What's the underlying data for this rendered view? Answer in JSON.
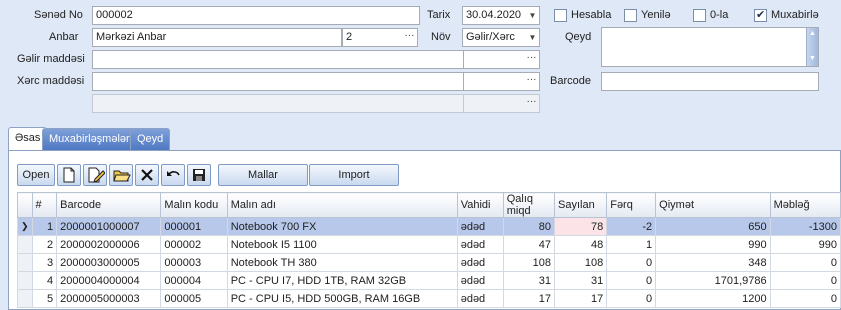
{
  "form": {
    "doc_no_label": "Sənəd No",
    "doc_no_value": "000002",
    "date_label": "Tarix",
    "date_value": "30.04.2020",
    "anbar_label": "Anbar",
    "anbar_value": "Mərkəzi Anbar",
    "anbar_code": "2",
    "nov_label": "Növ",
    "nov_value": "Gəlir/Xərc",
    "qeyd_label": "Qeyd",
    "gelir_label": "Gəlir maddəsi",
    "xerc_label": "Xərc maddəsi",
    "barcode_label": "Barcode"
  },
  "checkboxes": [
    {
      "label": "Hesabla",
      "checked": false
    },
    {
      "label": "Yenilə",
      "checked": false
    },
    {
      "label": "0-la",
      "checked": false
    },
    {
      "label": "Muxabirlə",
      "checked": true
    }
  ],
  "tabs": [
    "Əsas",
    "Muxabirləşmələr",
    "Qeyd"
  ],
  "toolbar": {
    "open": "Open",
    "mallar": "Mallar",
    "import": "Import"
  },
  "table": {
    "headers": [
      "#",
      "Barcode",
      "Malın kodu",
      "Malın adı",
      "Vahidi",
      "Qalıq miqd",
      "Sayılan",
      "Fərq",
      "Qiymət",
      "Məbləğ"
    ],
    "rows": [
      [
        "1",
        "2000001000007",
        "000001",
        "Notebook 700 FX",
        "ədəd",
        "80",
        "78",
        "-2",
        "650",
        "-1300"
      ],
      [
        "2",
        "2000002000006",
        "000002",
        "Notebook I5 1100",
        "ədəd",
        "47",
        "48",
        "1",
        "990",
        "990"
      ],
      [
        "3",
        "2000003000005",
        "000003",
        "Notebook TH 380",
        "ədəd",
        "108",
        "108",
        "0",
        "348",
        "0"
      ],
      [
        "4",
        "2000004000004",
        "000004",
        "PC - CPU I7, HDD 1TB, RAM 32GB",
        "ədəd",
        "31",
        "31",
        "0",
        "1701,9786",
        "0"
      ],
      [
        "5",
        "2000005000003",
        "000005",
        "PC - CPU I5, HDD 500GB, RAM 16GB",
        "ədəd",
        "17",
        "17",
        "0",
        "1200",
        "0"
      ]
    ],
    "selected_row": 0
  },
  "icons": [
    "new-doc-icon",
    "edit-doc-icon",
    "open-folder-icon",
    "delete-icon",
    "undo-icon",
    "save-icon"
  ]
}
